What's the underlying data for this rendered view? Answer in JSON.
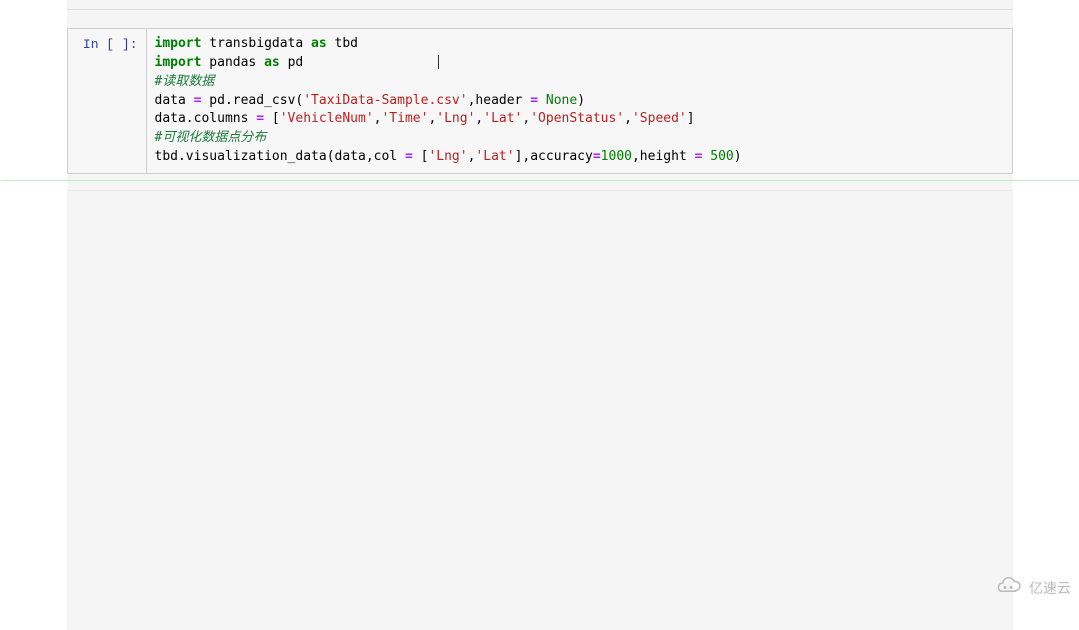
{
  "cell": {
    "prompt": "In [ ]:",
    "code": {
      "line1": {
        "kw1": "import",
        "mod1": "transbigdata",
        "kw2": "as",
        "alias1": "tbd"
      },
      "line2": {
        "kw1": "import",
        "mod1": "pandas",
        "kw2": "as",
        "alias1": "pd"
      },
      "line3_comment": "#读取数据",
      "line4": {
        "lhs": "data",
        "op": "=",
        "fn": "pd.read_csv",
        "lp": "(",
        "str1": "'TaxiData-Sample.csv'",
        "c1": ",header ",
        "op2": "=",
        "sp": " ",
        "none": "None",
        "rp": ")"
      },
      "line5": {
        "lhs": "data.columns ",
        "op": "=",
        "sp": " [",
        "s1": "'VehicleNum'",
        "c": ",",
        "s2": "'Time'",
        "s3": "'Lng'",
        "s4": "'Lat'",
        "s5": "'OpenStatus'",
        "s6": "'Speed'",
        "rb": "]"
      },
      "line6_comment": "#可视化数据点分布",
      "line7": {
        "fn": "tbd.visualization_data",
        "lp": "(data,col ",
        "op": "=",
        "sp": " [",
        "s1": "'Lng'",
        "c": ",",
        "s2": "'Lat'",
        "rb": "],accuracy",
        "op2": "=",
        "n1": "1000",
        "c2": ",height ",
        "op3": "=",
        "sp2": " ",
        "n2": "500",
        "rp": ")"
      }
    }
  },
  "watermark": {
    "text": "亿速云"
  }
}
